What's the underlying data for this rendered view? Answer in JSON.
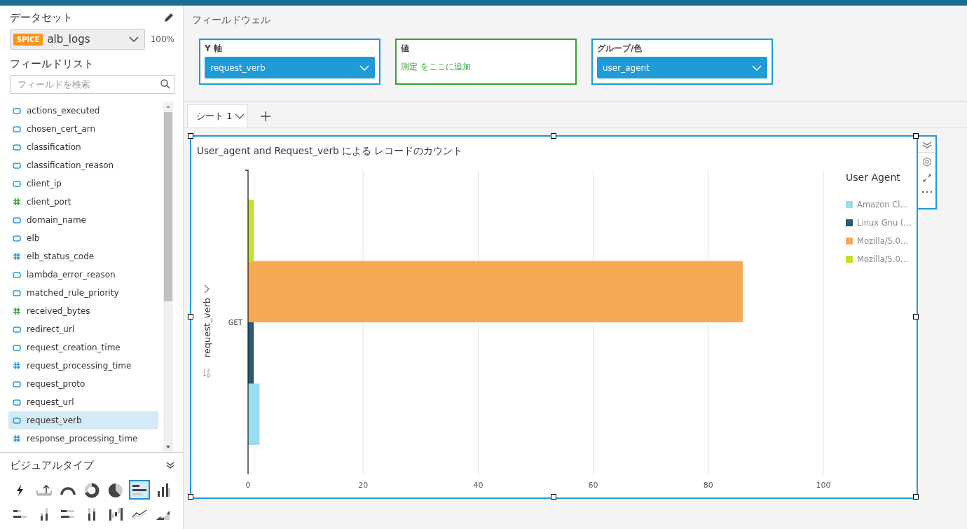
{
  "dataset_panel": {
    "title": "データセット",
    "dataset": {
      "badge": "SPICE",
      "name": "alb_logs"
    },
    "percent": "100%"
  },
  "field_list": {
    "title": "フィールドリスト",
    "search": {
      "placeholder": "フィールドを検索"
    },
    "fields": [
      {
        "name": "actions_executed",
        "kind": "dimension",
        "selected": false
      },
      {
        "name": "chosen_cert_arn",
        "kind": "dimension",
        "selected": false
      },
      {
        "name": "classification",
        "kind": "dimension",
        "selected": false
      },
      {
        "name": "classification_reason",
        "kind": "dimension",
        "selected": false
      },
      {
        "name": "client_ip",
        "kind": "dimension",
        "selected": false
      },
      {
        "name": "client_port",
        "kind": "measure",
        "selected": false
      },
      {
        "name": "domain_name",
        "kind": "dimension",
        "selected": false
      },
      {
        "name": "elb",
        "kind": "dimension",
        "selected": false
      },
      {
        "name": "elb_status_code",
        "kind": "numeric-dimension",
        "selected": false
      },
      {
        "name": "lambda_error_reason",
        "kind": "dimension",
        "selected": false
      },
      {
        "name": "matched_rule_priority",
        "kind": "dimension",
        "selected": false
      },
      {
        "name": "received_bytes",
        "kind": "measure",
        "selected": false
      },
      {
        "name": "redirect_url",
        "kind": "dimension",
        "selected": false
      },
      {
        "name": "request_creation_time",
        "kind": "dimension",
        "selected": false
      },
      {
        "name": "request_processing_time",
        "kind": "numeric-dimension",
        "selected": false
      },
      {
        "name": "request_proto",
        "kind": "dimension",
        "selected": false
      },
      {
        "name": "request_url",
        "kind": "dimension",
        "selected": false
      },
      {
        "name": "request_verb",
        "kind": "dimension",
        "selected": true
      },
      {
        "name": "response_processing_time",
        "kind": "numeric-dimension",
        "selected": false
      }
    ]
  },
  "visual_types": {
    "title": "ビジュアルタイプ",
    "items": [
      {
        "kind": "kpi",
        "selected": false
      },
      {
        "kind": "kpi-target",
        "selected": false
      },
      {
        "kind": "gauge",
        "selected": false
      },
      {
        "kind": "donut",
        "selected": false
      },
      {
        "kind": "pie",
        "selected": false
      },
      {
        "kind": "hbar",
        "selected": true
      },
      {
        "kind": "vbar",
        "selected": false
      },
      {
        "kind": "hbar-stacked",
        "selected": false
      },
      {
        "kind": "vbar-stacked",
        "selected": false
      },
      {
        "kind": "hbar-100",
        "selected": false
      },
      {
        "kind": "vbar-100",
        "selected": false
      },
      {
        "kind": "waterfall",
        "selected": false
      },
      {
        "kind": "line",
        "selected": false
      },
      {
        "kind": "area",
        "selected": false
      }
    ]
  },
  "field_wells": {
    "title": "フィールドウェル",
    "wells": [
      {
        "label": "Y 軸",
        "kind": "filled",
        "value": "request_verb"
      },
      {
        "label": "値",
        "kind": "empty",
        "hint": "測定 をここに追加"
      },
      {
        "label": "グループ/色",
        "kind": "filled",
        "value": "user_agent"
      }
    ]
  },
  "sheet_tabs": [
    {
      "label": "シート 1",
      "selected": true
    }
  ],
  "visual": {
    "selected": true,
    "legend_title": "User Agent",
    "chart_data": {
      "type": "bar",
      "orientation": "horizontal",
      "title": "User_agent and Request_verb による レコードのカウント",
      "ylabel": "request_verb",
      "categories": [
        "GET"
      ],
      "series": [
        {
          "name": "Amazon Cl…",
          "color": "#9bdcf0",
          "values": [
            2
          ]
        },
        {
          "name": "Linux Gnu (…",
          "color": "#2a5b74",
          "values": [
            1
          ]
        },
        {
          "name": "Mozilla/5.0…",
          "color": "#f5a953",
          "values": [
            86
          ]
        },
        {
          "name": "Mozilla/5.0…",
          "color": "#bfe22f",
          "values": [
            1
          ]
        }
      ],
      "grid": true,
      "xlim": [
        0,
        100
      ],
      "xticks": [
        0,
        20,
        40,
        60,
        80,
        100
      ]
    }
  }
}
